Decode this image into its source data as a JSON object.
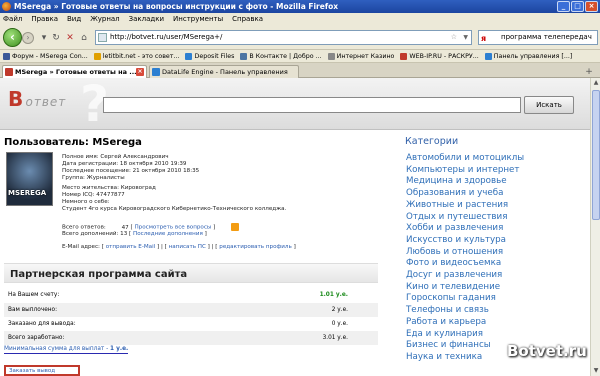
{
  "window": {
    "title": "MSerega » Готовые ответы на вопросы инструкции с фото - Mozilla Firefox"
  },
  "menu": [
    "Файл",
    "Правка",
    "Вид",
    "Журнал",
    "Закладки",
    "Инструменты",
    "Справка"
  ],
  "nav": {
    "url": "http://botvet.ru/user/MSerega+/",
    "search_value": "программа телепередач"
  },
  "bookmarks": [
    {
      "label": "Форум - MSerega Con...",
      "color": "#3b5998"
    },
    {
      "label": "letitbit.net - это совет...",
      "color": "#e0a000"
    },
    {
      "label": "Deposit Files",
      "color": "#2c7fd1"
    },
    {
      "label": "В Контакте | Добро ...",
      "color": "#4c75a3"
    },
    {
      "label": "Интернет Казино",
      "color": "#888888"
    },
    {
      "label": "WEB-IP.RU - РАСКРУ...",
      "color": "#c0392b"
    },
    {
      "label": "Панель управления [...]",
      "color": "#2c7fd1"
    }
  ],
  "tabs": [
    {
      "label": "MSerega » Готовые ответы на ...",
      "active": true
    },
    {
      "label": "DataLife Engine - Панель управления",
      "active": false
    }
  ],
  "site": {
    "logo_b": "В",
    "logo_rest": "ответ",
    "search_button": "Искать"
  },
  "profile": {
    "title": "Пользователь: MSerega",
    "avatar_text": "MSEREGA",
    "full_name": "Полное имя: Сергей Александрович",
    "reg_date": "Дата регистрации: 18 октября 2010 19:39",
    "last_visit": "Последнее посещение: 21 октября 2010 18:35",
    "group": "Группа: Журналисты",
    "location": "Место жительства: Кировоград",
    "icq": "Номер ICQ: 47477877",
    "about_label": "Немного о себе:",
    "about": "Студент 4го курса Кировоградского Кибернетико-Технического колледжа.",
    "answers_label": "Всего ответов:",
    "answers_count": "47",
    "answers_link": "Просмотреть все вопросы",
    "additions_label": "Всего дополнений:",
    "additions_count": "13",
    "additions_link": "Последние дополнения",
    "email_label": "E-Mail адрес:",
    "email_link": "отправить E-Mail",
    "pm_link": "написать ПС",
    "edit_link": "редактировать профиль"
  },
  "partner": {
    "title": "Партнерская программа сайта",
    "rows": [
      {
        "label": "На Вашем счету:",
        "value": "1.01 у.е."
      },
      {
        "label": "Вам выплочено:",
        "value": "2 у.е."
      },
      {
        "label": "Заказано для вывода:",
        "value": "0 у.е."
      },
      {
        "label": "Всего заработано:",
        "value": "3.01 у.е."
      }
    ],
    "min_sum_label": "Минимальная сумма для выплат -",
    "min_sum_value": "1 у.е.",
    "order_button": "Заказать вывод средств"
  },
  "categories": {
    "title": "Категории",
    "items": [
      "Автомобили и мотоциклы",
      "Компьютеры и интернет",
      "Медицина и здоровье",
      "Образования и учеба",
      "Животные и растения",
      "Отдых и путешествия",
      "Хобби и развлечения",
      "Искусство и культура",
      "Любовь и отношения",
      "Фото и видеосъемка",
      "Досуг и развлечения",
      "Кино и телевидение",
      "Гороскопы гадания",
      "Телефоны и связь",
      "Работа и карьера",
      "Еда и кулинария",
      "Бизнес и финансы",
      "Наука и техника"
    ]
  },
  "watermark": "Botvet.ru"
}
